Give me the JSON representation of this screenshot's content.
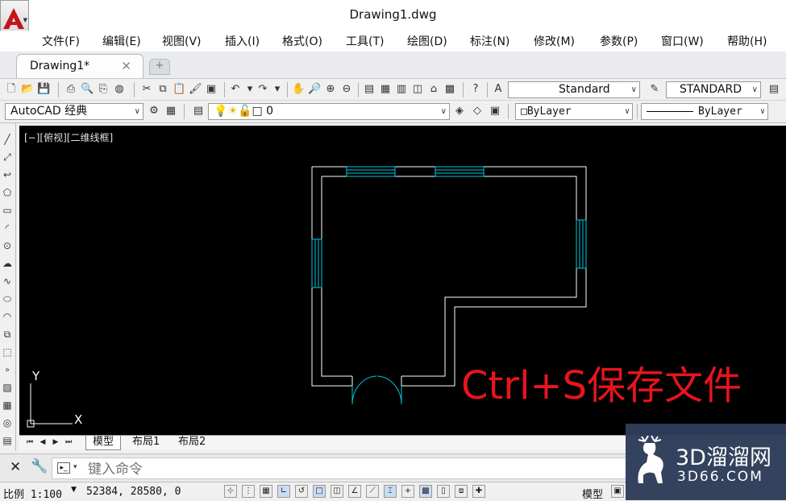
{
  "window": {
    "title": "Drawing1.dwg"
  },
  "menu": [
    "文件(F)",
    "编辑(E)",
    "视图(V)",
    "插入(I)",
    "格式(O)",
    "工具(T)",
    "绘图(D)",
    "标注(N)",
    "修改(M)",
    "参数(P)",
    "窗口(W)",
    "帮助(H)"
  ],
  "tabs": {
    "active": "Drawing1*",
    "close": "✕",
    "new": "+"
  },
  "toolbar1": {
    "text_style": "Standard",
    "dim_style": "STANDARD"
  },
  "toolbar2": {
    "workspace": "AutoCAD 经典",
    "layer": "0",
    "color": "ByLayer",
    "linetype": "ByLayer"
  },
  "viewport": {
    "label": "[−][俯视][二维线框]",
    "overlay": "Ctrl+S保存文件",
    "ucs_x": "X",
    "ucs_y": "Y"
  },
  "layout_tabs": [
    "模型",
    "布局1",
    "布局2"
  ],
  "command": {
    "placeholder": "键入命令",
    "close": "✕",
    "wrench": "🔧"
  },
  "status": {
    "scale": "比例 1:100",
    "coords": "52384, 28580, 0",
    "model": "模型"
  },
  "watermark": {
    "line1": "3D溜溜网",
    "line2": "3D66.COM"
  },
  "colors": {
    "canvas_bg": "#000000",
    "wall": "#ffffff",
    "window": "#00c8e0",
    "overlay_text": "#e8141c"
  }
}
